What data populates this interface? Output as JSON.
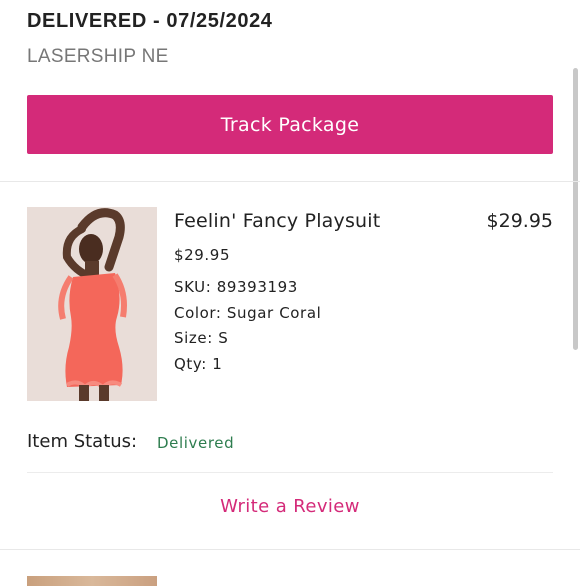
{
  "shipment": {
    "status_line": "DELIVERED - 07/25/2024",
    "carrier": "LASERSHIP NE",
    "track_button": "Track Package"
  },
  "item": {
    "name": "Feelin' Fancy Playsuit",
    "price_right": "$29.95",
    "price": "$29.95",
    "sku": "SKU: 89393193",
    "color": "Color: Sugar Coral",
    "size": "Size: S",
    "qty": "Qty: 1",
    "status_label": "Item Status:",
    "status_value": "Delivered",
    "review_link": "Write a Review"
  },
  "colors": {
    "accent": "#d42a79",
    "status_delivered": "#2e7d4f"
  }
}
